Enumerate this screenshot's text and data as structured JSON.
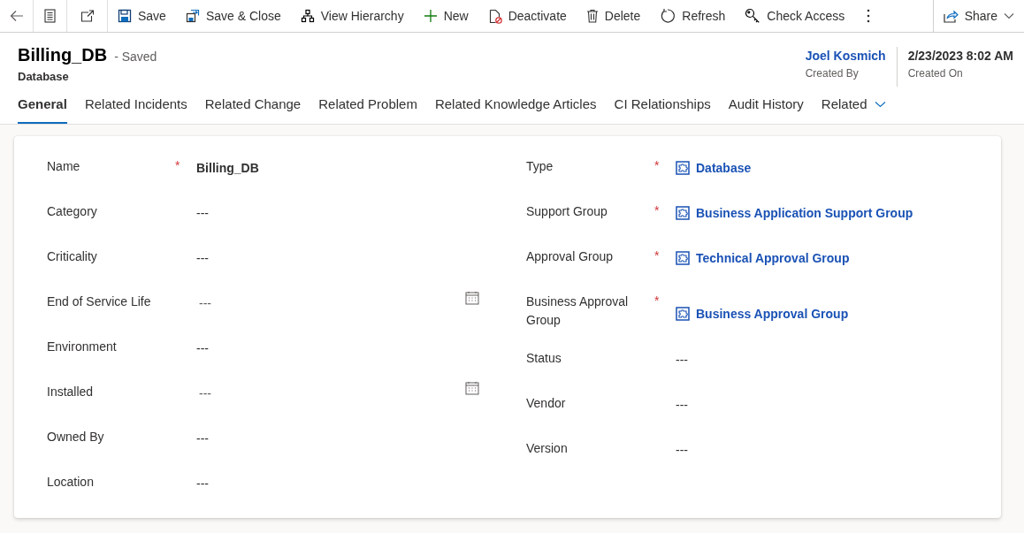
{
  "toolbar": {
    "items": [
      {
        "label": "Save"
      },
      {
        "label": "Save & Close"
      },
      {
        "label": "View Hierarchy"
      },
      {
        "label": "New"
      },
      {
        "label": "Deactivate"
      },
      {
        "label": "Delete"
      },
      {
        "label": "Refresh"
      },
      {
        "label": "Check Access"
      }
    ],
    "share": "Share"
  },
  "header": {
    "title": "Billing_DB",
    "save_state": "- Saved",
    "entity": "Database",
    "fields": [
      {
        "value": "Joel Kosmich",
        "label": "Created By",
        "kind": "link"
      },
      {
        "value": "2/23/2023 8:02 AM",
        "label": "Created On",
        "kind": "text"
      }
    ]
  },
  "tabs": [
    {
      "label": "General",
      "selected": true
    },
    {
      "label": "Related Incidents",
      "selected": false
    },
    {
      "label": "Related Change",
      "selected": false
    },
    {
      "label": "Related Problem",
      "selected": false
    },
    {
      "label": "Related Knowledge Articles",
      "selected": false
    },
    {
      "label": "CI Relationships",
      "selected": false
    },
    {
      "label": "Audit History",
      "selected": false
    },
    {
      "label": "Related",
      "selected": false,
      "kind": "menu"
    }
  ],
  "left_fields": [
    {
      "label": "Name",
      "required_mark": "*",
      "value": "Billing_DB",
      "kind": "text"
    },
    {
      "label": "Category",
      "value": "---",
      "kind": "text"
    },
    {
      "label": "Criticality",
      "value": "---",
      "kind": "text"
    },
    {
      "label": "End of Service Life",
      "value": "---",
      "kind": "date"
    },
    {
      "label": "Environment",
      "value": "---",
      "kind": "text"
    },
    {
      "label": "Installed",
      "value": "---",
      "kind": "date"
    },
    {
      "label": "Owned By",
      "value": "---",
      "kind": "text"
    },
    {
      "label": "Location",
      "value": "---",
      "kind": "text"
    }
  ],
  "right_fields": [
    {
      "label": "Type",
      "required_mark": "*",
      "value": "Database",
      "kind": "lookup"
    },
    {
      "label": "Support Group",
      "required_mark": "*",
      "value": "Business Application Support Group",
      "kind": "lookup"
    },
    {
      "label": "Approval Group",
      "required_mark": "*",
      "value": "Technical Approval Group",
      "kind": "lookup"
    },
    {
      "label": "Business Approval Group",
      "required_mark": "*",
      "value": "Business Approval Group",
      "kind": "lookup"
    },
    {
      "label": "Status",
      "value": "---",
      "kind": "text"
    },
    {
      "label": "Vendor",
      "value": "---",
      "kind": "text"
    },
    {
      "label": "Version",
      "value": "---",
      "kind": "text"
    }
  ]
}
